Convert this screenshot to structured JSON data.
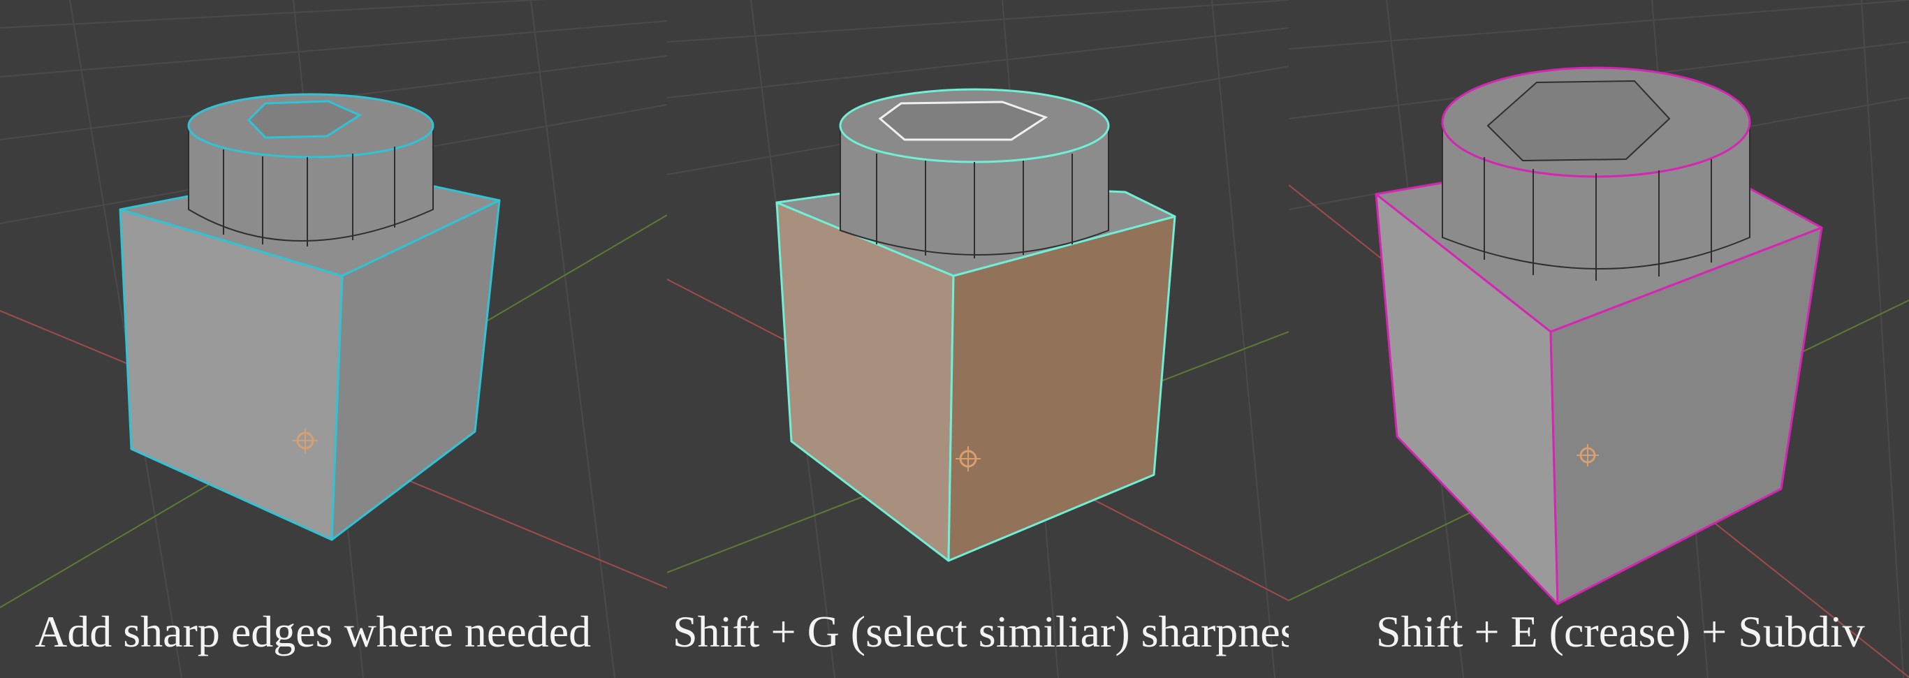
{
  "panels": [
    {
      "caption": "Add sharp edges where needed",
      "highlight": "#2ec4d6",
      "front_fill": "#9a9a9a",
      "side_fill": "#878787",
      "highlight_mode": "sharp"
    },
    {
      "caption": "Shift + G (select similiar) sharpness",
      "highlight": "#6ff0d6",
      "front_fill": "#a98f7d",
      "side_fill": "#93725a",
      "highlight_mode": "selected"
    },
    {
      "caption": "Shift + E (crease) + Subdiv",
      "highlight": "#d624b4",
      "front_fill": "#9a9a9a",
      "side_fill": "#858585",
      "highlight_mode": "crease"
    }
  ],
  "colors": {
    "background": "#3d3d3d",
    "grid": "#4a4a4a",
    "axis_x": "#a24b4b",
    "axis_y": "#5e7a33",
    "top_face": "#8e8e8e",
    "cylinder": "#8c8c8c",
    "wire": "#2e2e2e",
    "origin": "#d8a070"
  }
}
